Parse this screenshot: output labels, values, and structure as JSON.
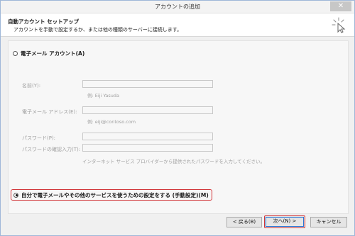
{
  "window": {
    "title": "アカウントの追加",
    "close_glyph": "✕"
  },
  "header": {
    "title": "自動アカウント セットアップ",
    "description": "アカウントを手動で設定するか、または他の種類のサーバーに接続します。",
    "icon": "sparkle-cursor-icon"
  },
  "email_option": {
    "label": "電子メール アカウント(A)",
    "selected": false
  },
  "fields": {
    "name": {
      "label": "名前(Y):",
      "value": "",
      "example": "例: Eiji Yasuda"
    },
    "email": {
      "label": "電子メール アドレス(E):",
      "value": "",
      "example": "例: eiji@contoso.com"
    },
    "password": {
      "label": "パスワード(P):",
      "value": ""
    },
    "password_confirm": {
      "label": "パスワードの確認入力(T):",
      "value": ""
    },
    "hint": "インターネット サービス プロバイダーから提供されたパスワードを入力してください。"
  },
  "manual_option": {
    "label": "自分で電子メールやその他のサービスを使うための設定をする (手動設定)(M)",
    "selected": true
  },
  "buttons": {
    "back": "< 戻る(B)",
    "next": "次へ(N) >",
    "cancel": "キャンセル"
  },
  "colors": {
    "highlight": "#d13438",
    "focus": "#2b79d7"
  }
}
